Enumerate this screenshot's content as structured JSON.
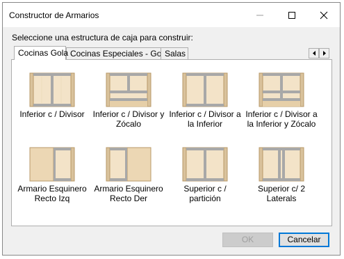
{
  "window": {
    "title": "Constructor de Armarios"
  },
  "prompt": "Seleccione una estructura de caja para construir:",
  "tabs": [
    {
      "label": "Cocinas Gola"
    },
    {
      "label": "Cocinas Especiales - Gola"
    },
    {
      "label": "Salas"
    }
  ],
  "items": [
    {
      "label": "Inferior c / Divisor"
    },
    {
      "label": "Inferior c / Divisor y Zócalo"
    },
    {
      "label": "Inferior c / Divisor a la Inferior"
    },
    {
      "label": "Inferior c / Divisor a la Inferior y Zócalo"
    },
    {
      "label": "Armario Esquinero Recto Izq"
    },
    {
      "label": "Armario Esquinero Recto Der"
    },
    {
      "label": "Superior c / partición"
    },
    {
      "label": "Superior c/ 2 Laterals"
    }
  ],
  "buttons": {
    "ok": "OK",
    "cancel": "Cancelar"
  },
  "colors": {
    "wood_light": "#f3e3c8",
    "wood_edge": "#c8a878",
    "gray_panel": "#a8a8a8"
  }
}
